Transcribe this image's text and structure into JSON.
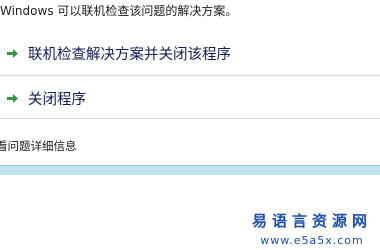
{
  "intro_text": "Windows 可以联机检查该问题的解决方案。",
  "options": [
    {
      "label": "联机检查解决方案并关闭该程序",
      "icon": "green-arrow-icon"
    },
    {
      "label": "关闭程序",
      "icon": "green-arrow-icon"
    }
  ],
  "details_link": "看问题详细信息",
  "watermark": {
    "title": "易语言资源网",
    "url": "www.e5a5x.com"
  },
  "colors": {
    "arrow": "#2f9a3a",
    "option_text": "#151c55",
    "footer_band": "#bfe3f0",
    "watermark": "#1b4ea8"
  }
}
